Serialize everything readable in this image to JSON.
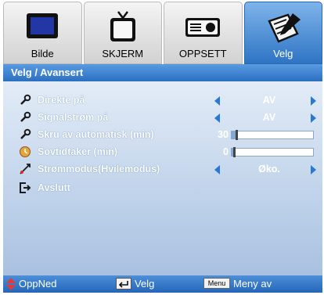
{
  "tabs": [
    {
      "label": "Bilde",
      "icon": "monitor-icon",
      "active": false
    },
    {
      "label": "SKJERM",
      "icon": "tv-icon",
      "active": false
    },
    {
      "label": "OPPSETT",
      "icon": "projector-icon",
      "active": false
    },
    {
      "label": "Velg",
      "icon": "options-icon",
      "active": true
    }
  ],
  "breadcrumb": "Velg / Avansert",
  "rows": [
    {
      "label": "Direkte på",
      "icon": "wrench-icon",
      "value": "AV"
    },
    {
      "label": "Signalstrøm på",
      "icon": "wrench-icon",
      "value": "AV"
    },
    {
      "label": "Skru av automatisk (min)",
      "icon": "wrench-icon",
      "value": "30",
      "slider_fraction": 0.05
    },
    {
      "label": "Sovtidtaker (min)",
      "icon": "timer-icon",
      "value": "0",
      "slider_fraction": 0.0
    },
    {
      "label": "Strømmodus(Hvilemodus)",
      "icon": "power-mode-icon",
      "value": "Øko."
    },
    {
      "label": "Avslutt",
      "icon": "exit-icon"
    }
  ],
  "footer": {
    "navigate": "OppNed",
    "select": "Velg",
    "menu_key": "Menu",
    "menu_off": "Meny av"
  },
  "colors": {
    "accent_blue": "#2b6fc2",
    "arrow_blue": "#2b77d6",
    "active_tab": "#3f84d0",
    "panel_top": "#e3ecf7",
    "panel_bottom": "#a9c1e0"
  }
}
